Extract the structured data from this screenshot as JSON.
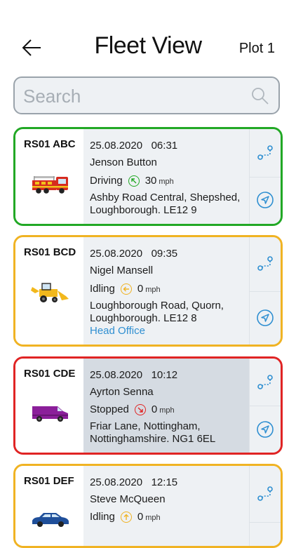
{
  "header": {
    "title": "Fleet View",
    "plot": "Plot 1"
  },
  "search": {
    "placeholder": "Search"
  },
  "colors": {
    "driving": "#22a825",
    "idling": "#f0b323",
    "stopped": "#e02424",
    "accent": "#2f8fd1"
  },
  "vehicles": [
    {
      "reg": "RS01 ABC",
      "vehicle_icon": "fire-truck-icon",
      "date": "25.08.2020",
      "time": "06:31",
      "driver": "Jenson Button",
      "status": "Driving",
      "speed": "30",
      "unit": "mph",
      "address1": "Ashby Road Central, Shepshed,",
      "address2": "Loughborough. LE12 9"
    },
    {
      "reg": "RS01 BCD",
      "vehicle_icon": "digger-icon",
      "date": "25.08.2020",
      "time": "09:35",
      "driver": "Nigel Mansell",
      "status": "Idling",
      "speed": "0",
      "unit": "mph",
      "address1": "Loughborough Road, Quorn,",
      "address2": "Loughborough. LE12 8",
      "location_tag": "Head Office"
    },
    {
      "reg": "RS01 CDE",
      "vehicle_icon": "van-icon",
      "date": "25.08.2020",
      "time": "10:12",
      "driver": "Ayrton Senna",
      "status": "Stopped",
      "speed": "0",
      "unit": "mph",
      "address1": "Friar Lane, Nottingham,",
      "address2": "Nottinghamshire. NG1 6EL"
    },
    {
      "reg": "RS01 DEF",
      "vehicle_icon": "car-icon",
      "date": "25.08.2020",
      "time": "12:15",
      "driver": "Steve McQueen",
      "status": "Idling",
      "speed": "0",
      "unit": "mph"
    }
  ]
}
